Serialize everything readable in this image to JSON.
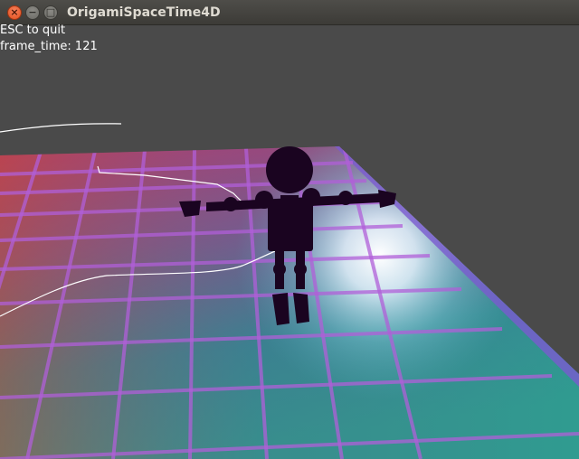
{
  "window": {
    "title": "OrigamiSpaceTime4D"
  },
  "window_controls": {
    "close": "×",
    "minimize": "−",
    "maximize": "□"
  },
  "hud": {
    "line1": "ESC to quit",
    "line2": "frame_time: 121"
  },
  "colors": {
    "background": "#4a4a4a",
    "grid": "#b05fd8",
    "character": "#1a0420",
    "trail": "#ffffff"
  }
}
